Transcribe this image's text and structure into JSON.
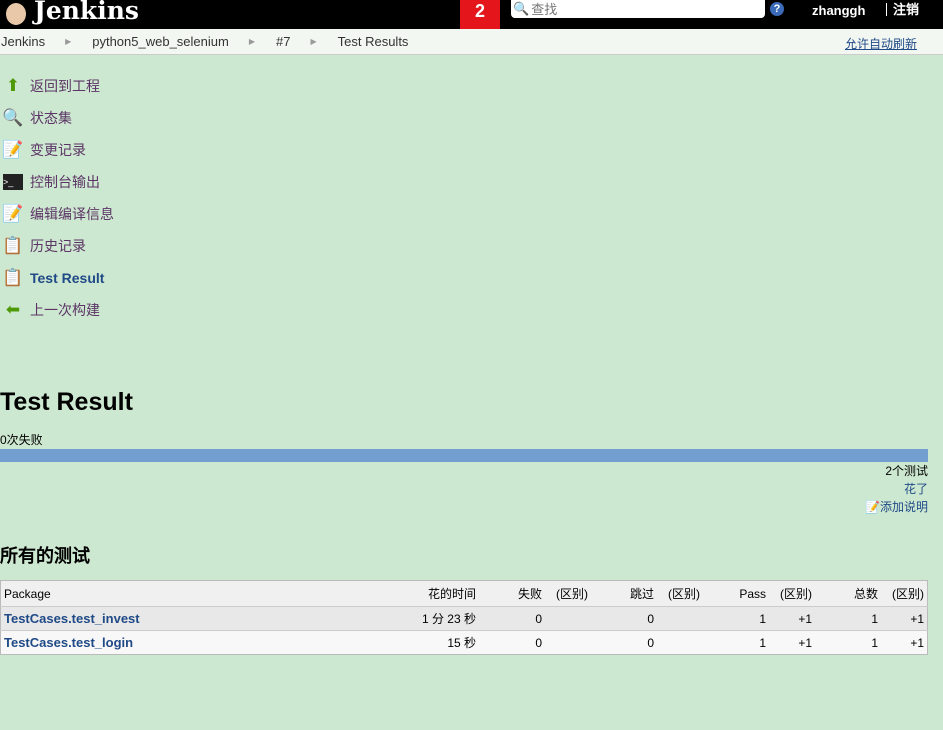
{
  "header": {
    "logo_text": "Jenkins",
    "badge": "2",
    "search_placeholder": "查找",
    "help": "?",
    "user": "zhanggh",
    "logout": "注销"
  },
  "breadcrumb": {
    "items": [
      "Jenkins",
      "python5_web_selenium",
      "#7",
      "Test Results"
    ],
    "autorefresh": "允许自动刷新"
  },
  "sidebar": {
    "items": [
      {
        "label": "返回到工程",
        "icon": "up-arrow-icon"
      },
      {
        "label": "状态集",
        "icon": "search-icon"
      },
      {
        "label": "变更记录",
        "icon": "notepad-icon"
      },
      {
        "label": "控制台输出",
        "icon": "terminal-icon"
      },
      {
        "label": "编辑编译信息",
        "icon": "notepad-icon"
      },
      {
        "label": "历史记录",
        "icon": "history-icon"
      },
      {
        "label": "Test Result",
        "icon": "clipboard-icon"
      },
      {
        "label": "上一次构建",
        "icon": "left-arrow-icon"
      }
    ]
  },
  "main": {
    "title": "Test Result",
    "failures": "0次失败",
    "pass_fraction": 1.0,
    "total_tests": "2个测试",
    "took": "花了",
    "add_description": "添加说明",
    "section_title": "所有的测试",
    "columns": [
      "Package",
      "花的时间",
      "失败",
      "(区别)",
      "跳过",
      "(区别)",
      "Pass",
      "(区别)",
      "总数",
      "(区别)"
    ],
    "rows": [
      [
        "TestCases.test_invest",
        "1 分 23 秒",
        "0",
        "",
        "0",
        "",
        "1",
        "+1",
        "1",
        "+1"
      ],
      [
        "TestCases.test_login",
        "15 秒",
        "0",
        "",
        "0",
        "",
        "1",
        "+1",
        "1",
        "+1"
      ]
    ]
  },
  "colors": {
    "background": "#cde8d0",
    "bar": "#729fcf",
    "badge": "#e4161b"
  }
}
